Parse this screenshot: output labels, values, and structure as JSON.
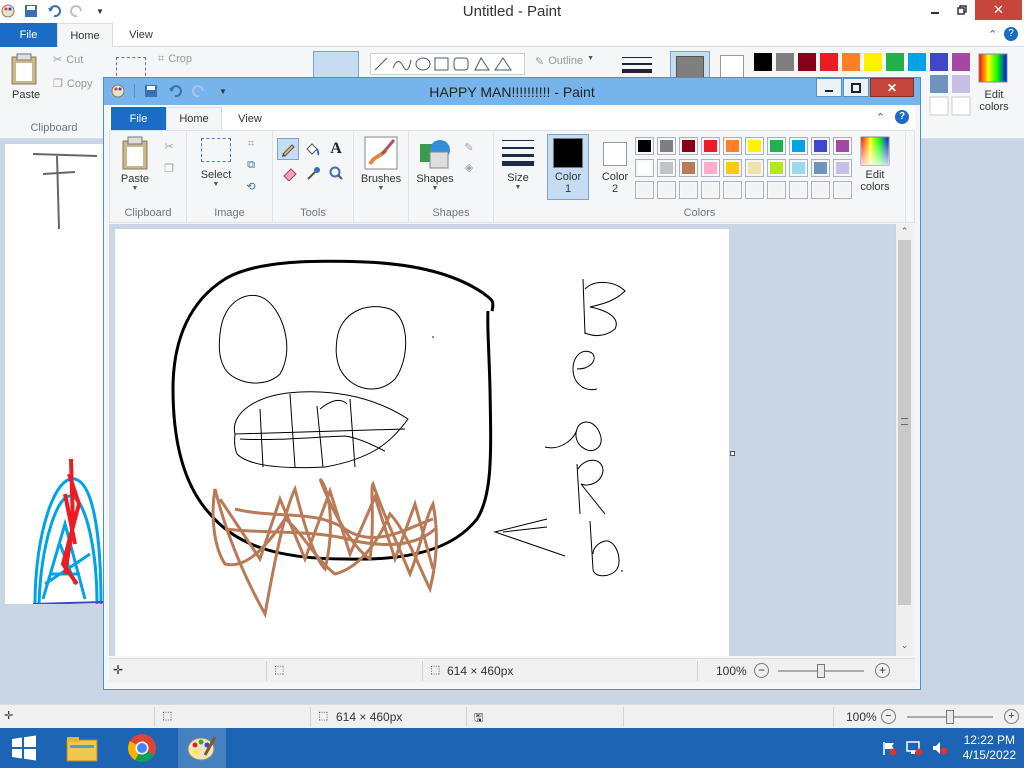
{
  "background_window": {
    "title": "Untitled - Paint",
    "tabs": [
      "File",
      "Home",
      "View"
    ],
    "ribbon": {
      "paste_label": "Paste",
      "clipboard_group": "Clipboard",
      "cut_label": "Cut",
      "copy_label": "Copy",
      "crop_label": "Crop",
      "outline_label": "Outline",
      "edit_colors_label": "Edit colors"
    },
    "status": {
      "size": "614 × 460px",
      "zoom": "100%"
    }
  },
  "window": {
    "title": "HAPPY MAN!!!!!!!!!! - Paint",
    "tabs": {
      "file": "File",
      "home": "Home",
      "view": "View"
    },
    "ribbon": {
      "clipboard": {
        "paste": "Paste",
        "group": "Clipboard"
      },
      "image": {
        "select": "Select",
        "group": "Image"
      },
      "tools": {
        "group": "Tools"
      },
      "brushes": {
        "label": "Brushes"
      },
      "shapes": {
        "label": "Shapes",
        "group": "Shapes"
      },
      "size": {
        "label": "Size"
      },
      "color1": {
        "label": "Color",
        "num": "1"
      },
      "color2": {
        "label": "Color",
        "num": "2"
      },
      "colors_group": "Colors",
      "edit_colors": {
        "line1": "Edit",
        "line2": "colors"
      }
    },
    "palette_row1": [
      "#000000",
      "#7f7f7f",
      "#880015",
      "#ed1c24",
      "#ff7f27",
      "#fff200",
      "#22b14c",
      "#00a2e8",
      "#3f48cc",
      "#a349a4"
    ],
    "palette_row2": [
      "#ffffff",
      "#c3c3c3",
      "#b97a57",
      "#ffaec9",
      "#ffc90e",
      "#efe4b0",
      "#b5e61d",
      "#99d9ea",
      "#7092be",
      "#c8bfe7"
    ],
    "status": {
      "size": "614 × 460px",
      "zoom": "100%"
    }
  },
  "taskbar": {
    "clock_time": "12:22 PM",
    "clock_date": "4/15/2022"
  },
  "colors": {
    "accent": "#1a6cc4",
    "titlebar": "#78b4ec",
    "taskbar": "#1d64b4",
    "beard": "#b97a57"
  }
}
